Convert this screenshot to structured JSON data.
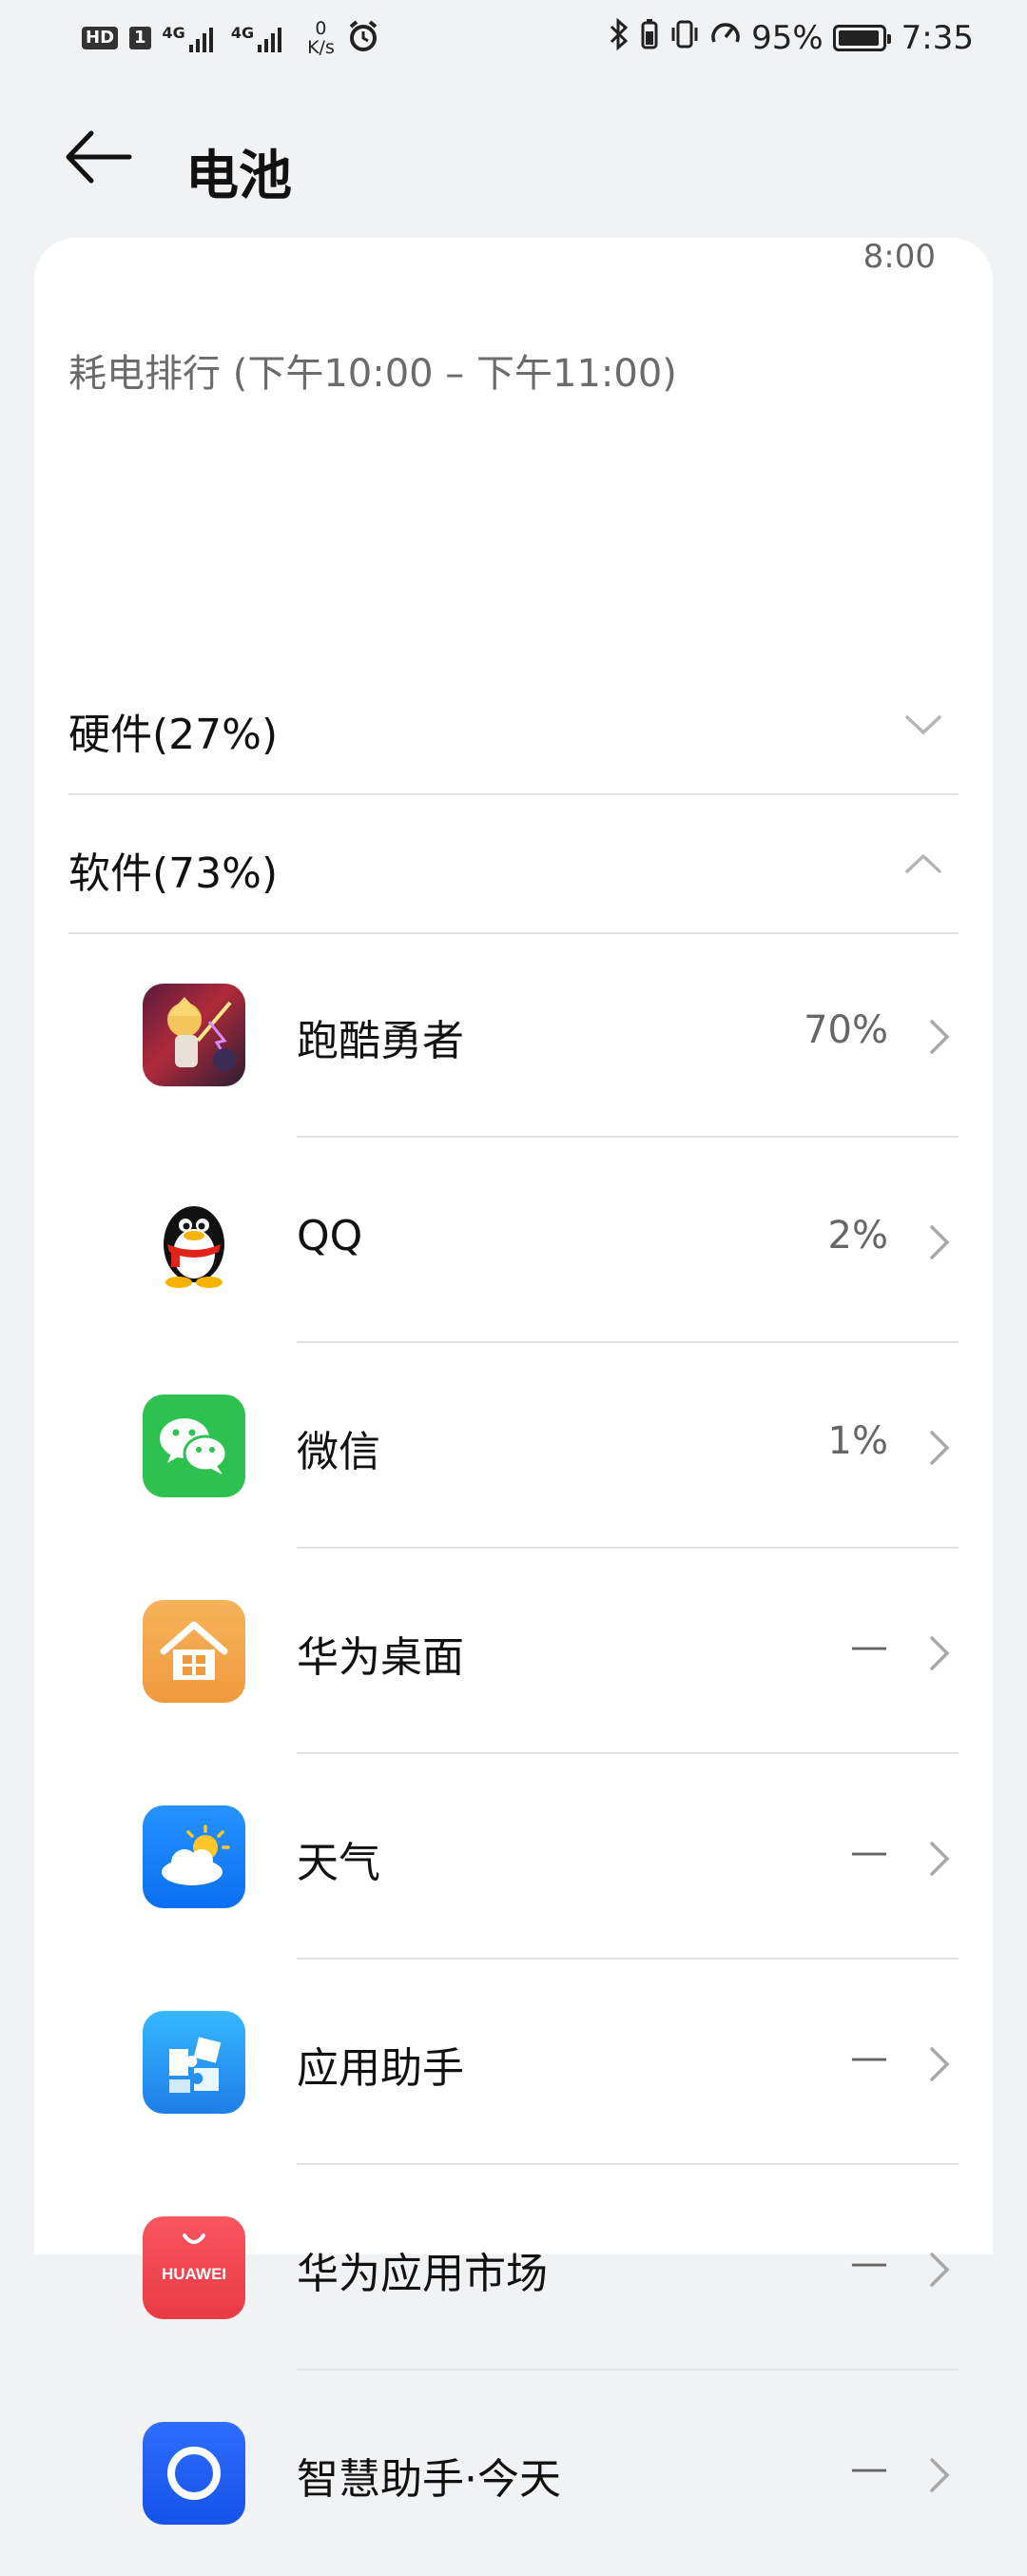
{
  "status_bar": {
    "left": {
      "hd": "HD",
      "sim": "1",
      "net1": "4G",
      "net2": "4G",
      "speed_value": "0",
      "speed_unit": "K/s"
    },
    "right": {
      "battery_percent": "95%",
      "time": "7:35",
      "battery_level": 0.95
    }
  },
  "header": {
    "title": "电池",
    "back_icon": "back-arrow-icon"
  },
  "card": {
    "time_tick": "8:00",
    "ranking_title": "耗电排行 (下午10:00 – 下午11:00)",
    "groups": [
      {
        "label": "硬件(27%)",
        "icon": "chevron-down-icon",
        "expanded": false
      },
      {
        "label": "软件(73%)",
        "icon": "chevron-up-icon",
        "expanded": true
      }
    ],
    "apps": [
      {
        "name": "跑酷勇者",
        "value": "70%",
        "icon": "game-hero-icon"
      },
      {
        "name": "QQ",
        "value": "2%",
        "icon": "qq-penguin-icon"
      },
      {
        "name": "微信",
        "value": "1%",
        "icon": "wechat-icon"
      },
      {
        "name": "华为桌面",
        "value": "—",
        "icon": "huawei-home-icon"
      },
      {
        "name": "天气",
        "value": "—",
        "icon": "weather-icon"
      },
      {
        "name": "应用助手",
        "value": "—",
        "icon": "app-assistant-icon"
      },
      {
        "name": "华为应用市场",
        "value": "—",
        "icon": "huawei-appgallery-icon",
        "icon_text": "HUAWEI"
      },
      {
        "name": "智慧助手·今天",
        "value": "—",
        "icon": "smart-assistant-icon"
      }
    ]
  },
  "colors": {
    "background": "#f1f2f4",
    "card": "#ffffff",
    "wechat_green": "#2dc150",
    "appgallery_red": "#f0454f",
    "home_orange": "#f4a24b",
    "weather_blue": "#0a7cf5",
    "assistant_blue": "#1f8cf3"
  }
}
